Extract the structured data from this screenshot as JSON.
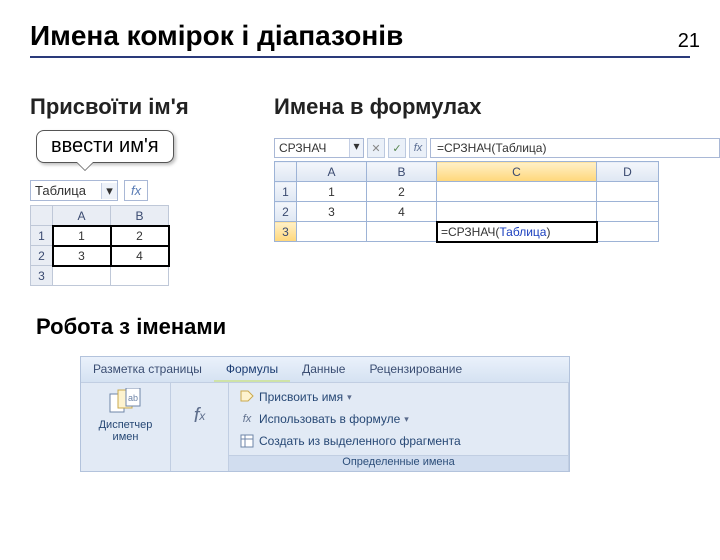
{
  "page_number": "21",
  "title": "Имена комірок і діапазонів",
  "headings": {
    "assign": "Присвоїти ім'я",
    "formulas": "Имена в формулах",
    "work": "Робота з іменами"
  },
  "bubble": "ввести им'я",
  "left_sheet": {
    "name_box": "Таблица",
    "fx_label": "fx",
    "cols": [
      "A",
      "B"
    ],
    "rows": [
      {
        "n": "1",
        "cells": [
          "1",
          "2"
        ]
      },
      {
        "n": "2",
        "cells": [
          "3",
          "4"
        ]
      },
      {
        "n": "3",
        "cells": [
          "",
          ""
        ]
      }
    ]
  },
  "right_sheet": {
    "name_box": "СРЗНАЧ",
    "buttons": {
      "cancel": "✕",
      "ok": "✓",
      "fx": "fx"
    },
    "formula_bar": "=СРЗНАЧ(Таблица)",
    "cols": [
      "A",
      "B",
      "C",
      "D"
    ],
    "rows": [
      {
        "n": "1",
        "cells": [
          "1",
          "2",
          "",
          ""
        ]
      },
      {
        "n": "2",
        "cells": [
          "3",
          "4",
          "",
          ""
        ]
      },
      {
        "n": "3",
        "cells": [
          "",
          "",
          "",
          ""
        ]
      }
    ],
    "active_cell": {
      "prefix": "=СРЗНАЧ(",
      "argument": "Таблица",
      "suffix": ")"
    }
  },
  "ribbon": {
    "tabs": {
      "layout": "Разметка страницы",
      "formulas": "Формулы",
      "data": "Данные",
      "review": "Рецензирование"
    },
    "name_manager": {
      "label_line1": "Диспетчер",
      "label_line2": "имен"
    },
    "menu": {
      "assign": "Присвоить имя",
      "use": "Использовать в формуле",
      "create": "Создать из выделенного фрагмента"
    },
    "group_label": "Определенные имена"
  }
}
